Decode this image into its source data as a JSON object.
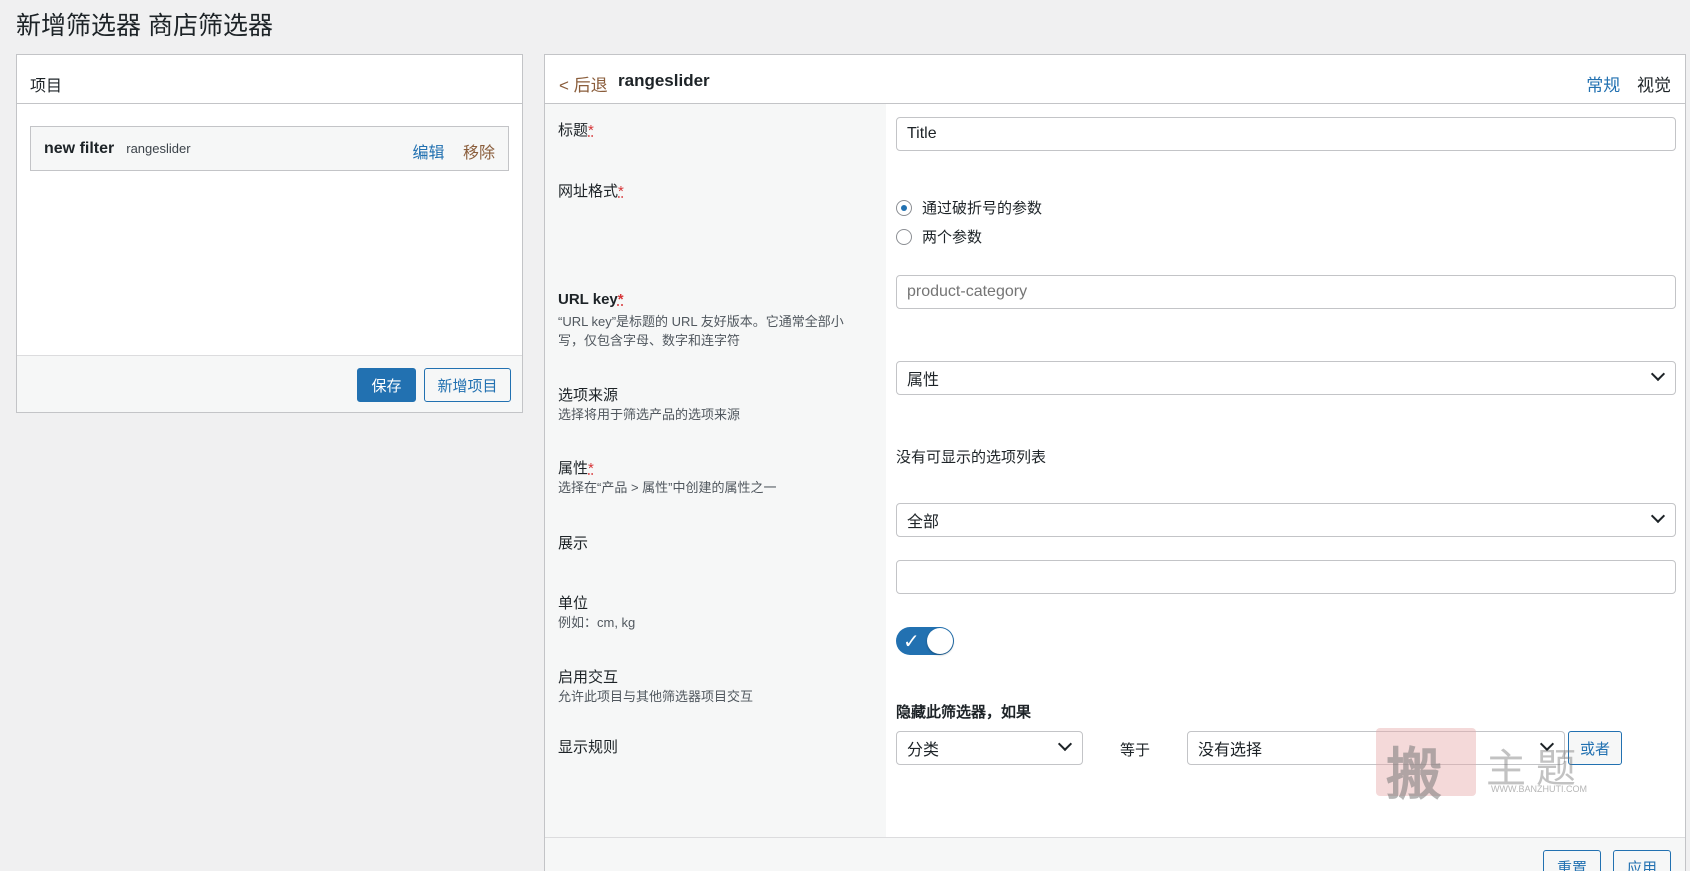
{
  "page": {
    "title": "新增筛选器 商店筛选器"
  },
  "left_panel": {
    "header": "项目",
    "item": {
      "name": "new filter",
      "type": "rangeslider",
      "edit": "编辑",
      "remove": "移除"
    },
    "save_label": "保存",
    "add_item_label": "新增项目"
  },
  "right_panel": {
    "back": "< 后退",
    "title": "rangeslider",
    "tabs": {
      "general": "常规",
      "visual": "视觉"
    },
    "required_mark": "*",
    "fields": {
      "title": {
        "label": "标题",
        "value": "Title"
      },
      "url_format": {
        "label": "网址格式",
        "options": [
          "通过破折号的参数",
          "两个参数"
        ],
        "selected": "通过破折号的参数"
      },
      "url_key": {
        "label": "URL key",
        "desc": "“URL key”是标题的 URL 友好版本。它通常全部小写，仅包含字母、数字和连字符",
        "value": "product-category"
      },
      "source": {
        "label": "选项来源",
        "desc": "选择将用于筛选产品的选项来源",
        "value": "属性"
      },
      "attribute": {
        "label": "属性",
        "desc": "选择在“产品 > 属性”中创建的属性之一",
        "value": "没有可显示的选项列表"
      },
      "display": {
        "label": "展示",
        "value": "全部"
      },
      "unit": {
        "label": "单位",
        "desc": "例如：cm, kg",
        "value": ""
      },
      "interaction": {
        "label": "启用交互",
        "desc": "允许此项目与其他筛选器项目交互",
        "enabled": true
      },
      "rules": {
        "label": "显示规则",
        "heading": "隐藏此筛选器，如果",
        "field": "分类",
        "operator": "等于",
        "value": "没有选择",
        "or_label": "或者"
      }
    },
    "footer": {
      "reset": "重置",
      "apply": "应用"
    }
  },
  "watermark": {
    "char": "搬",
    "text": "主题",
    "small": "WWW.BANZHUTI.COM"
  },
  "colors": {
    "accent": "#2271b1",
    "back_link": "#8a5d3b",
    "required": "#d63638"
  }
}
